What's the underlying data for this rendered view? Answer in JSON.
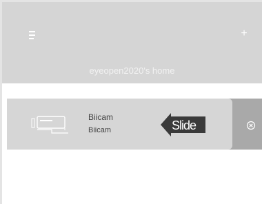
{
  "header": {
    "title": "eyeopen2020's home",
    "menu_icon": "menu-icon",
    "add_icon": "plus-icon"
  },
  "devices": [
    {
      "name": "Biicam",
      "model": "Biicam",
      "icon": "camera-icon",
      "hint": "Slide",
      "action_icon": "delete-icon"
    }
  ],
  "colors": {
    "header_bg": "#d5d5d5",
    "row_bg": "#d6d6d6",
    "action_bg": "#a9a9a9",
    "hint_bg": "#3a3a3a"
  }
}
